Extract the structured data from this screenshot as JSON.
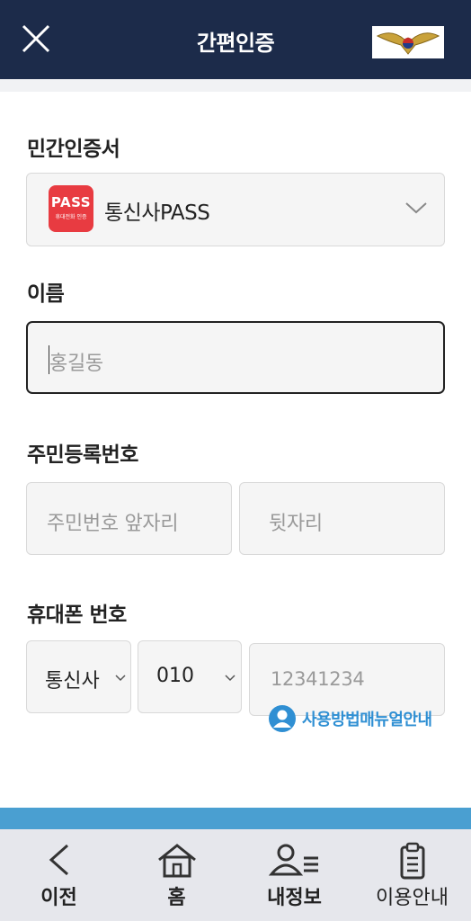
{
  "header": {
    "title": "간편인증"
  },
  "cert": {
    "label": "민간인증서",
    "logo_text": "PASS",
    "logo_subtext": "휴대전화 인증",
    "selected": "통신사PASS"
  },
  "name": {
    "label": "이름",
    "placeholder": "홍길동"
  },
  "rrn": {
    "label": "주민등록번호",
    "front_placeholder": "주민번호 앞자리",
    "back_placeholder": "뒷자리"
  },
  "phone": {
    "label": "휴대폰 번호",
    "carrier": "통신사",
    "prefix": "010",
    "number_placeholder": "12341234"
  },
  "manual_link": "사용방법매뉴얼안내",
  "tabs": [
    {
      "label": "이전",
      "icon": "back-icon"
    },
    {
      "label": "홈",
      "icon": "home-icon"
    },
    {
      "label": "내정보",
      "icon": "profile-icon"
    },
    {
      "label": "이용안내",
      "icon": "clipboard-icon"
    }
  ],
  "colors": {
    "header_bg": "#1c2b4a",
    "pass_red": "#e83b41",
    "accent_blue": "#4a9fd1",
    "link_blue": "#2f8fd3"
  }
}
